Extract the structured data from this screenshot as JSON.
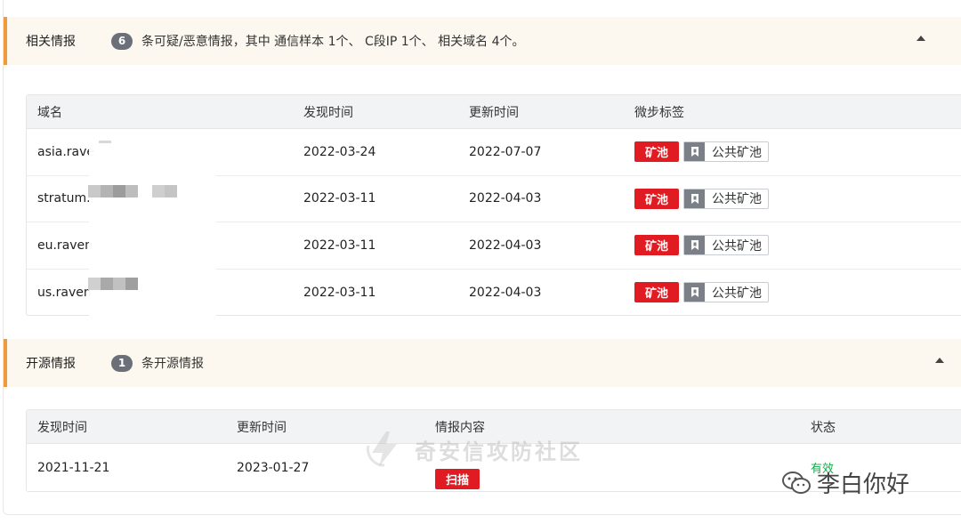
{
  "related": {
    "title": "相关情报",
    "count": "6",
    "desc": "条可疑/恶意情报，其中 通信样本 1个、 C段IP 1个、 相关域名 4个。",
    "columns": [
      "域名",
      "发现时间",
      "更新时间",
      "微步标签"
    ],
    "rows": [
      {
        "domain": "asia.rave",
        "found": "2022-03-24",
        "updated": "2022-07-07",
        "tag": "矿池",
        "tag2": "公共矿池"
      },
      {
        "domain": "stratum.r",
        "found": "2022-03-11",
        "updated": "2022-04-03",
        "tag": "矿池",
        "tag2": "公共矿池"
      },
      {
        "domain": "eu.raven",
        "found": "2022-03-11",
        "updated": "2022-04-03",
        "tag": "矿池",
        "tag2": "公共矿池"
      },
      {
        "domain": "us.raven",
        "found": "2022-03-11",
        "updated": "2022-04-03",
        "tag": "矿池",
        "tag2": "公共矿池"
      }
    ]
  },
  "opensource": {
    "title": "开源情报",
    "count": "1",
    "desc": "条开源情报",
    "columns": [
      "发现时间",
      "更新时间",
      "情报内容",
      "状态"
    ],
    "rows": [
      {
        "found": "2021-11-21",
        "updated": "2023-01-27",
        "content": "扫描",
        "status": "有效"
      }
    ]
  },
  "watermark": "奇安信攻防社区",
  "wechat_name": "李白你好",
  "colors": {
    "accent": "#f09a3e",
    "tag_red": "#e11b22",
    "status_green": "#19a94c"
  },
  "icons": {
    "caret": "caret-up-icon",
    "tag": "bookmark-icon"
  }
}
